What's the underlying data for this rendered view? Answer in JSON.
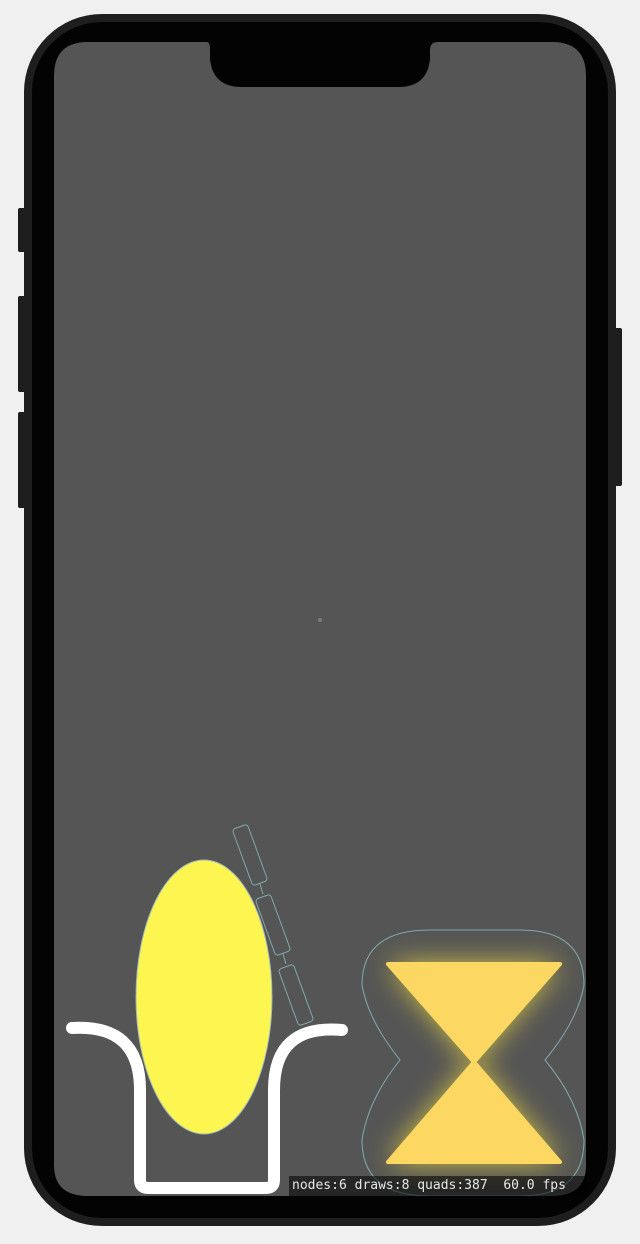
{
  "device": {
    "frame_color": "#1e1e1e",
    "bezel_color": "#030303",
    "screen_color": "#555555",
    "background_color": "#f0f0f0"
  },
  "scene": {
    "ellipse_node": {
      "fill": "#fdf651",
      "outline": "#9fb8c0"
    },
    "cup_node": {
      "stroke": "#ffffff"
    },
    "hourglass_node": {
      "fill": "#fcd862",
      "glow": "#f6e040",
      "outline": "#7fa9b0"
    },
    "rope_node": {
      "segments": 3,
      "outline": "#7fa9b0"
    }
  },
  "debug": {
    "stats_text": "nodes:6 draws:8 quads:387  60.0 fps"
  }
}
